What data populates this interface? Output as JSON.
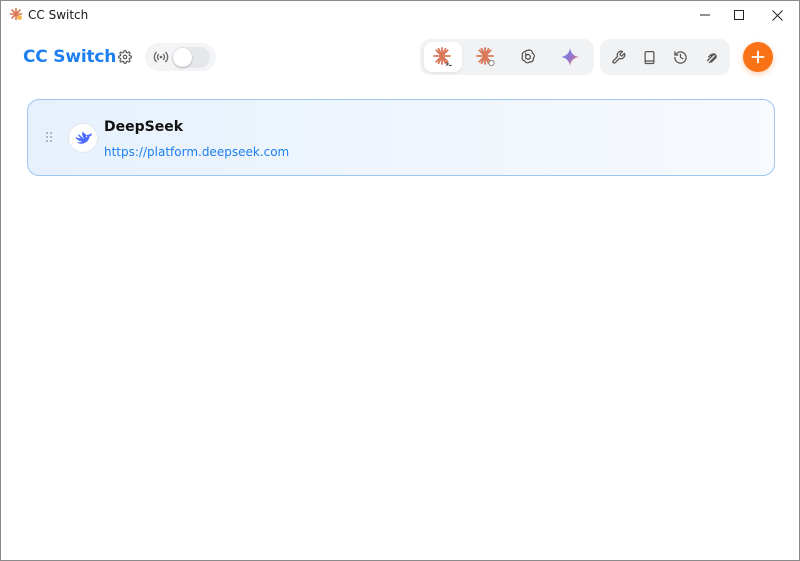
{
  "window": {
    "title": "CC Switch",
    "controls": [
      "minimize",
      "maximize",
      "close"
    ]
  },
  "header": {
    "brand": "CC Switch",
    "settings_icon": "gear-icon",
    "proxy_icon": "broadcast-icon",
    "proxy_toggle": false,
    "app_tabs": [
      {
        "name": "claude-code",
        "icon": "claude-terminal-icon",
        "active": true
      },
      {
        "name": "claude",
        "icon": "claude-icon",
        "active": false
      },
      {
        "name": "codex",
        "icon": "openai-icon",
        "active": false
      },
      {
        "name": "gemini",
        "icon": "gemini-icon",
        "active": false
      }
    ],
    "tools": [
      "wrench-icon",
      "book-icon",
      "history-icon",
      "skills-icon"
    ],
    "add_icon": "plus-icon"
  },
  "providers": [
    {
      "name": "DeepSeek",
      "url": "https://platform.deepseek.com",
      "icon": "deepseek-whale-icon",
      "selected": true
    }
  ],
  "colors": {
    "brand": "#1d7ff0",
    "accent_orange": "#f97316",
    "claude_orange": "#d97757",
    "card_border": "#9cc6f0",
    "deepseek_blue": "#4d6bfe"
  }
}
